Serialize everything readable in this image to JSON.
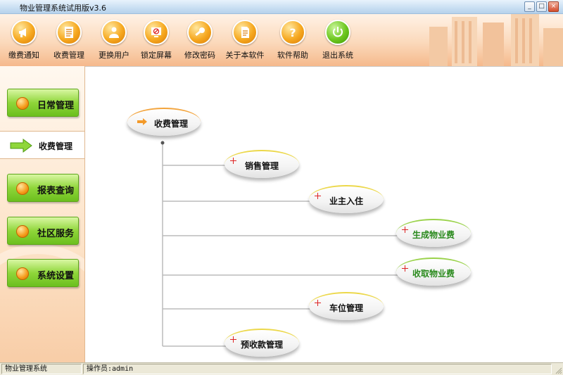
{
  "window": {
    "title": "物业管理系统试用版v3.6",
    "minimize": "_",
    "maximize": "□",
    "close": "×"
  },
  "toolbar": {
    "items": [
      {
        "label": "缴费通知",
        "icon": "megaphone-icon"
      },
      {
        "label": "收费管理",
        "icon": "document-list-icon"
      },
      {
        "label": "更换用户",
        "icon": "user-switch-icon"
      },
      {
        "label": "锁定屏幕",
        "icon": "lock-screen-icon"
      },
      {
        "label": "修改密码",
        "icon": "key-icon"
      },
      {
        "label": "关于本软件",
        "icon": "about-document-icon"
      },
      {
        "label": "软件帮助",
        "icon": "help-question-icon"
      },
      {
        "label": "退出系统",
        "icon": "power-icon"
      }
    ]
  },
  "sidebar": {
    "items": [
      {
        "label": "日常管理",
        "active": false
      },
      {
        "label": "收费管理",
        "active": true
      },
      {
        "label": "报表查询",
        "active": false
      },
      {
        "label": "社区服务",
        "active": false
      },
      {
        "label": "系统设置",
        "active": false
      }
    ]
  },
  "tree": {
    "root": "收费管理",
    "children": [
      {
        "label": "销售管理",
        "rim": "yellow"
      },
      {
        "label": "业主入住",
        "rim": "yellow"
      },
      {
        "label": "生成物业费",
        "rim": "green"
      },
      {
        "label": "收取物业费",
        "rim": "green"
      },
      {
        "label": "车位管理",
        "rim": "yellow"
      },
      {
        "label": "预收款管理",
        "rim": "yellow"
      }
    ]
  },
  "statusbar": {
    "system": "物业管理系统",
    "operator": "操作员:admin"
  },
  "colors": {
    "toolbar_orange": "#f6a81f",
    "nav_green": "#8fd63a",
    "label_green": "#2a8a1d"
  }
}
